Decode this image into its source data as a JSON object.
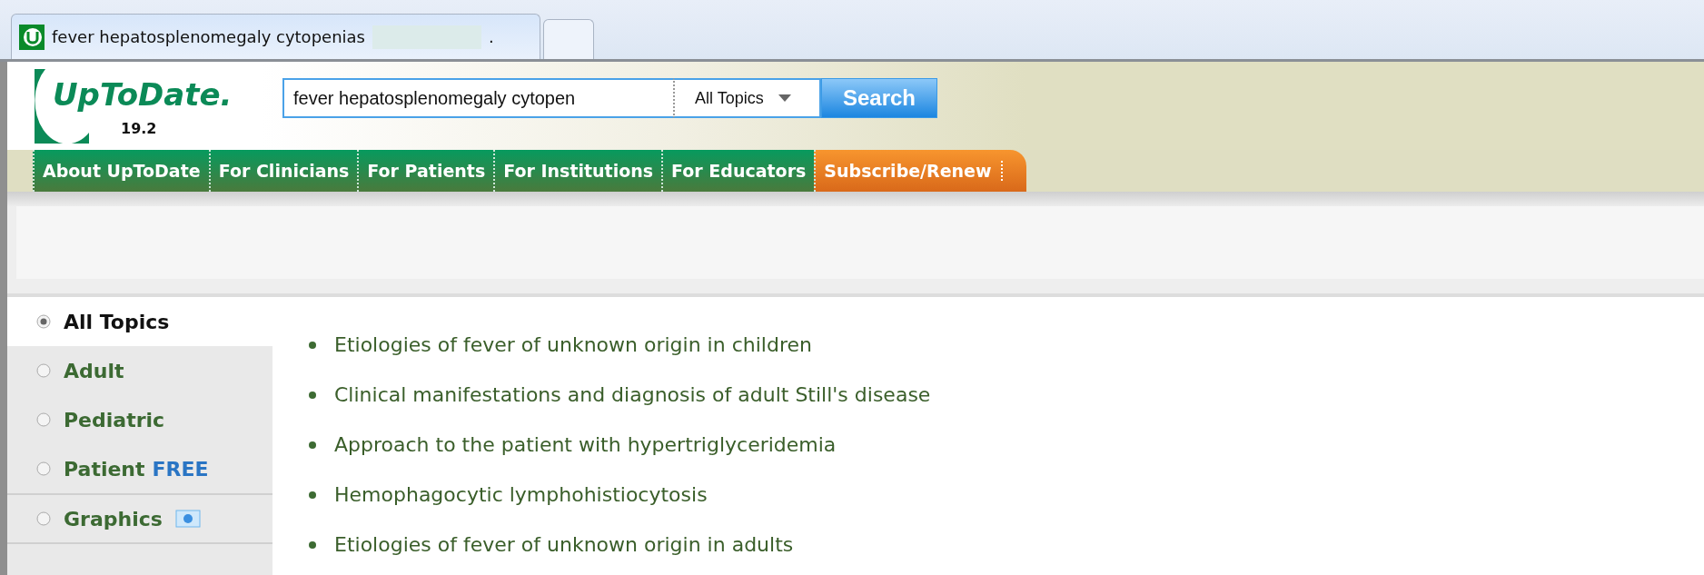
{
  "browser_tabs": [
    {
      "kind": "page",
      "title": "fever hepatosplenomegaly cytopenias",
      "title_tail": ".",
      "selected": true
    },
    {
      "kind": "new",
      "selected": false
    }
  ],
  "header": {
    "logo": "UpToDate.",
    "version": "19.2",
    "search": {
      "value": "fever hepatosplenomegaly cytopen",
      "scope": "All Topics",
      "button": "Search"
    }
  },
  "nav": [
    {
      "label": "About UpToDate",
      "kind": "normal"
    },
    {
      "label": "For Clinicians",
      "kind": "normal"
    },
    {
      "label": "For Patients",
      "kind": "normal"
    },
    {
      "label": "For Institutions",
      "kind": "normal"
    },
    {
      "label": "For Educators",
      "kind": "normal"
    },
    {
      "label": "Subscribe/Renew",
      "kind": "promo"
    }
  ],
  "filters": [
    {
      "label": "All Topics",
      "selected": true
    },
    {
      "label": "Adult",
      "selected": false
    },
    {
      "label": "Pediatric",
      "selected": false
    },
    {
      "label": "Patient",
      "badge": "FREE",
      "selected": false
    },
    {
      "label": "Graphics",
      "icon": true,
      "selected": false
    }
  ],
  "results": [
    "Etiologies of fever of unknown origin in children",
    "Clinical manifestations and diagnosis of adult Still's disease",
    "Approach to the patient with hypertriglyceridemia",
    "Hemophagocytic lymphohistiocytosis",
    "Etiologies of fever of unknown origin in adults"
  ]
}
